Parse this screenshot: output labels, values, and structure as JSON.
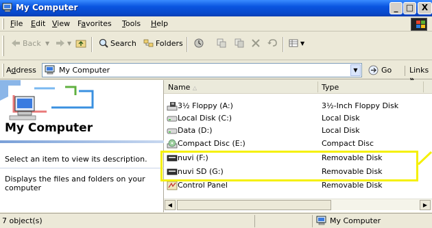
{
  "window": {
    "title": "My Computer"
  },
  "window_buttons": {
    "minimize": "_",
    "maximize": "□",
    "close": "X"
  },
  "menu": [
    {
      "label": "File",
      "hotkey": "F"
    },
    {
      "label": "Edit",
      "hotkey": "E"
    },
    {
      "label": "View",
      "hotkey": "V"
    },
    {
      "label": "Favorites",
      "hotkey": "a"
    },
    {
      "label": "Tools",
      "hotkey": "T"
    },
    {
      "label": "Help",
      "hotkey": "H"
    }
  ],
  "toolbar": {
    "back": "Back",
    "search": "Search",
    "folders": "Folders"
  },
  "address": {
    "label": "Address",
    "value": "My Computer",
    "go": "Go",
    "links": "Links"
  },
  "left_pane": {
    "title": "My Computer",
    "hint": "Select an item to view its description.",
    "description": "Displays the files and folders on your computer"
  },
  "columns": {
    "name": "Name",
    "type": "Type"
  },
  "items": [
    {
      "name": "3½ Floppy (A:)",
      "type": "3½-Inch Floppy Disk",
      "icon": "floppy-drive-icon"
    },
    {
      "name": "Local Disk (C:)",
      "type": "Local Disk",
      "icon": "hard-disk-icon"
    },
    {
      "name": "Data (D:)",
      "type": "Local Disk",
      "icon": "hard-disk-icon"
    },
    {
      "name": "Compact Disc (E:)",
      "type": "Compact Disc",
      "icon": "cd-drive-icon"
    },
    {
      "name": "nuvi (F:)",
      "type": "Removable Disk",
      "icon": "removable-disk-icon"
    },
    {
      "name": "nuvi SD (G:)",
      "type": "Removable Disk",
      "icon": "removable-disk-icon"
    },
    {
      "name": "Control Panel",
      "type": "Removable Disk",
      "icon": "control-panel-icon"
    }
  ],
  "status": {
    "count": "7 object(s)",
    "location": "My Computer"
  },
  "colors": {
    "titlebar": "#0a55e0",
    "highlight": "#f5f000",
    "window_bg": "#ece9d8"
  }
}
